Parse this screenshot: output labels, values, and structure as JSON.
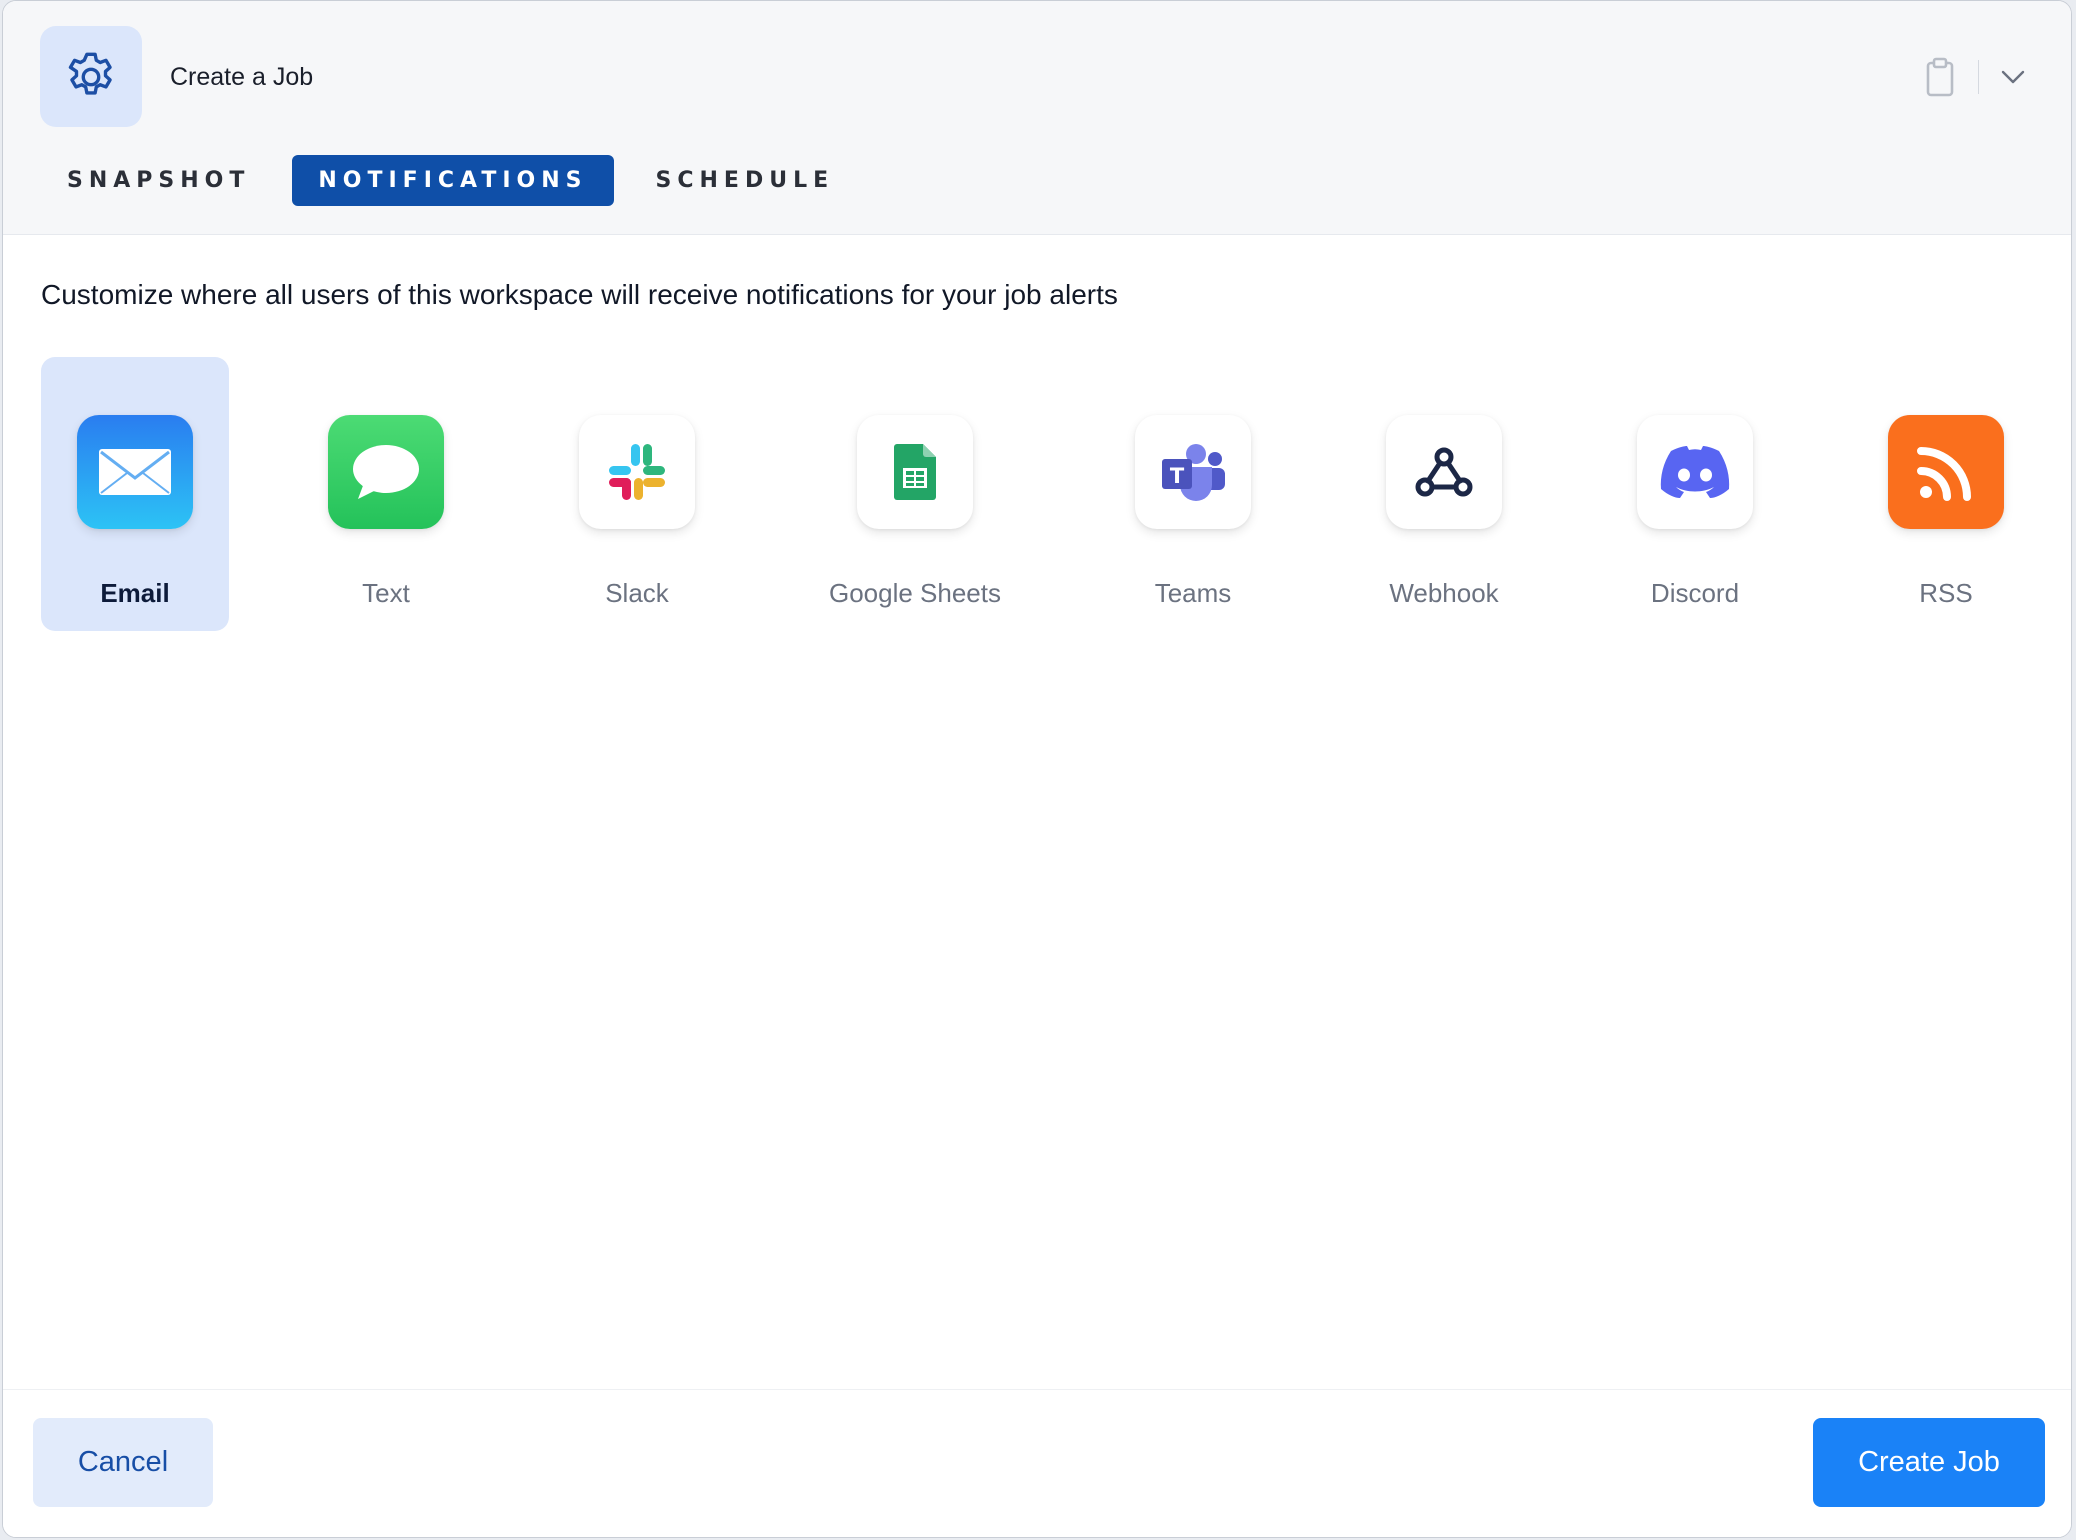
{
  "dialog": {
    "title": "Create a Job"
  },
  "tabs": [
    {
      "label": "SNAPSHOT",
      "active": false
    },
    {
      "label": "NOTIFICATIONS",
      "active": true
    },
    {
      "label": "SCHEDULE",
      "active": false
    }
  ],
  "description": "Customize where all users of this workspace will receive notifications for your job alerts",
  "channels": [
    {
      "label": "Email",
      "icon": "mail-icon",
      "selected": true
    },
    {
      "label": "Text",
      "icon": "message-bubble-icon",
      "selected": false
    },
    {
      "label": "Slack",
      "icon": "slack-icon",
      "selected": false
    },
    {
      "label": "Google Sheets",
      "icon": "google-sheets-icon",
      "selected": false
    },
    {
      "label": "Teams",
      "icon": "teams-icon",
      "selected": false
    },
    {
      "label": "Webhook",
      "icon": "webhook-icon",
      "selected": false
    },
    {
      "label": "Discord",
      "icon": "discord-icon",
      "selected": false
    },
    {
      "label": "RSS",
      "icon": "rss-icon",
      "selected": false
    }
  ],
  "footer": {
    "cancel_label": "Cancel",
    "create_label": "Create Job"
  },
  "colors": {
    "accent": "#1a82f7",
    "active_tab": "#0f4fa8",
    "selected_bg": "#dbe6fb"
  }
}
